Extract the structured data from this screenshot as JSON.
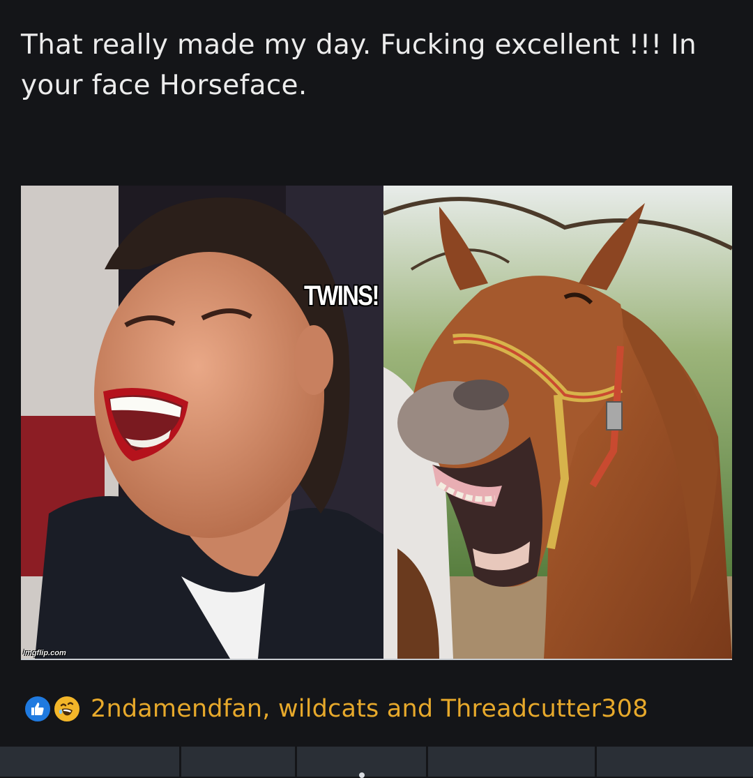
{
  "post": {
    "text": "That really made my day. Fucking excellent !!! In your face Horseface."
  },
  "meme": {
    "caption": "TWINS!",
    "watermark": "imgflip.com"
  },
  "reactions": {
    "icons": [
      "like-icon",
      "laugh-icon"
    ],
    "names": "2ndamendfan, wildcats and Threadcutter308",
    "name_color": "#e7a92b"
  },
  "bottom_bar": {
    "tabs": [
      "tab-1",
      "tab-2",
      "tab-3",
      "tab-4",
      "tab-5"
    ]
  },
  "colors": {
    "background": "#141518",
    "like_blue": "#1f7ae0",
    "laugh_yellow": "#f3b629",
    "bar": "#2a2f36"
  }
}
